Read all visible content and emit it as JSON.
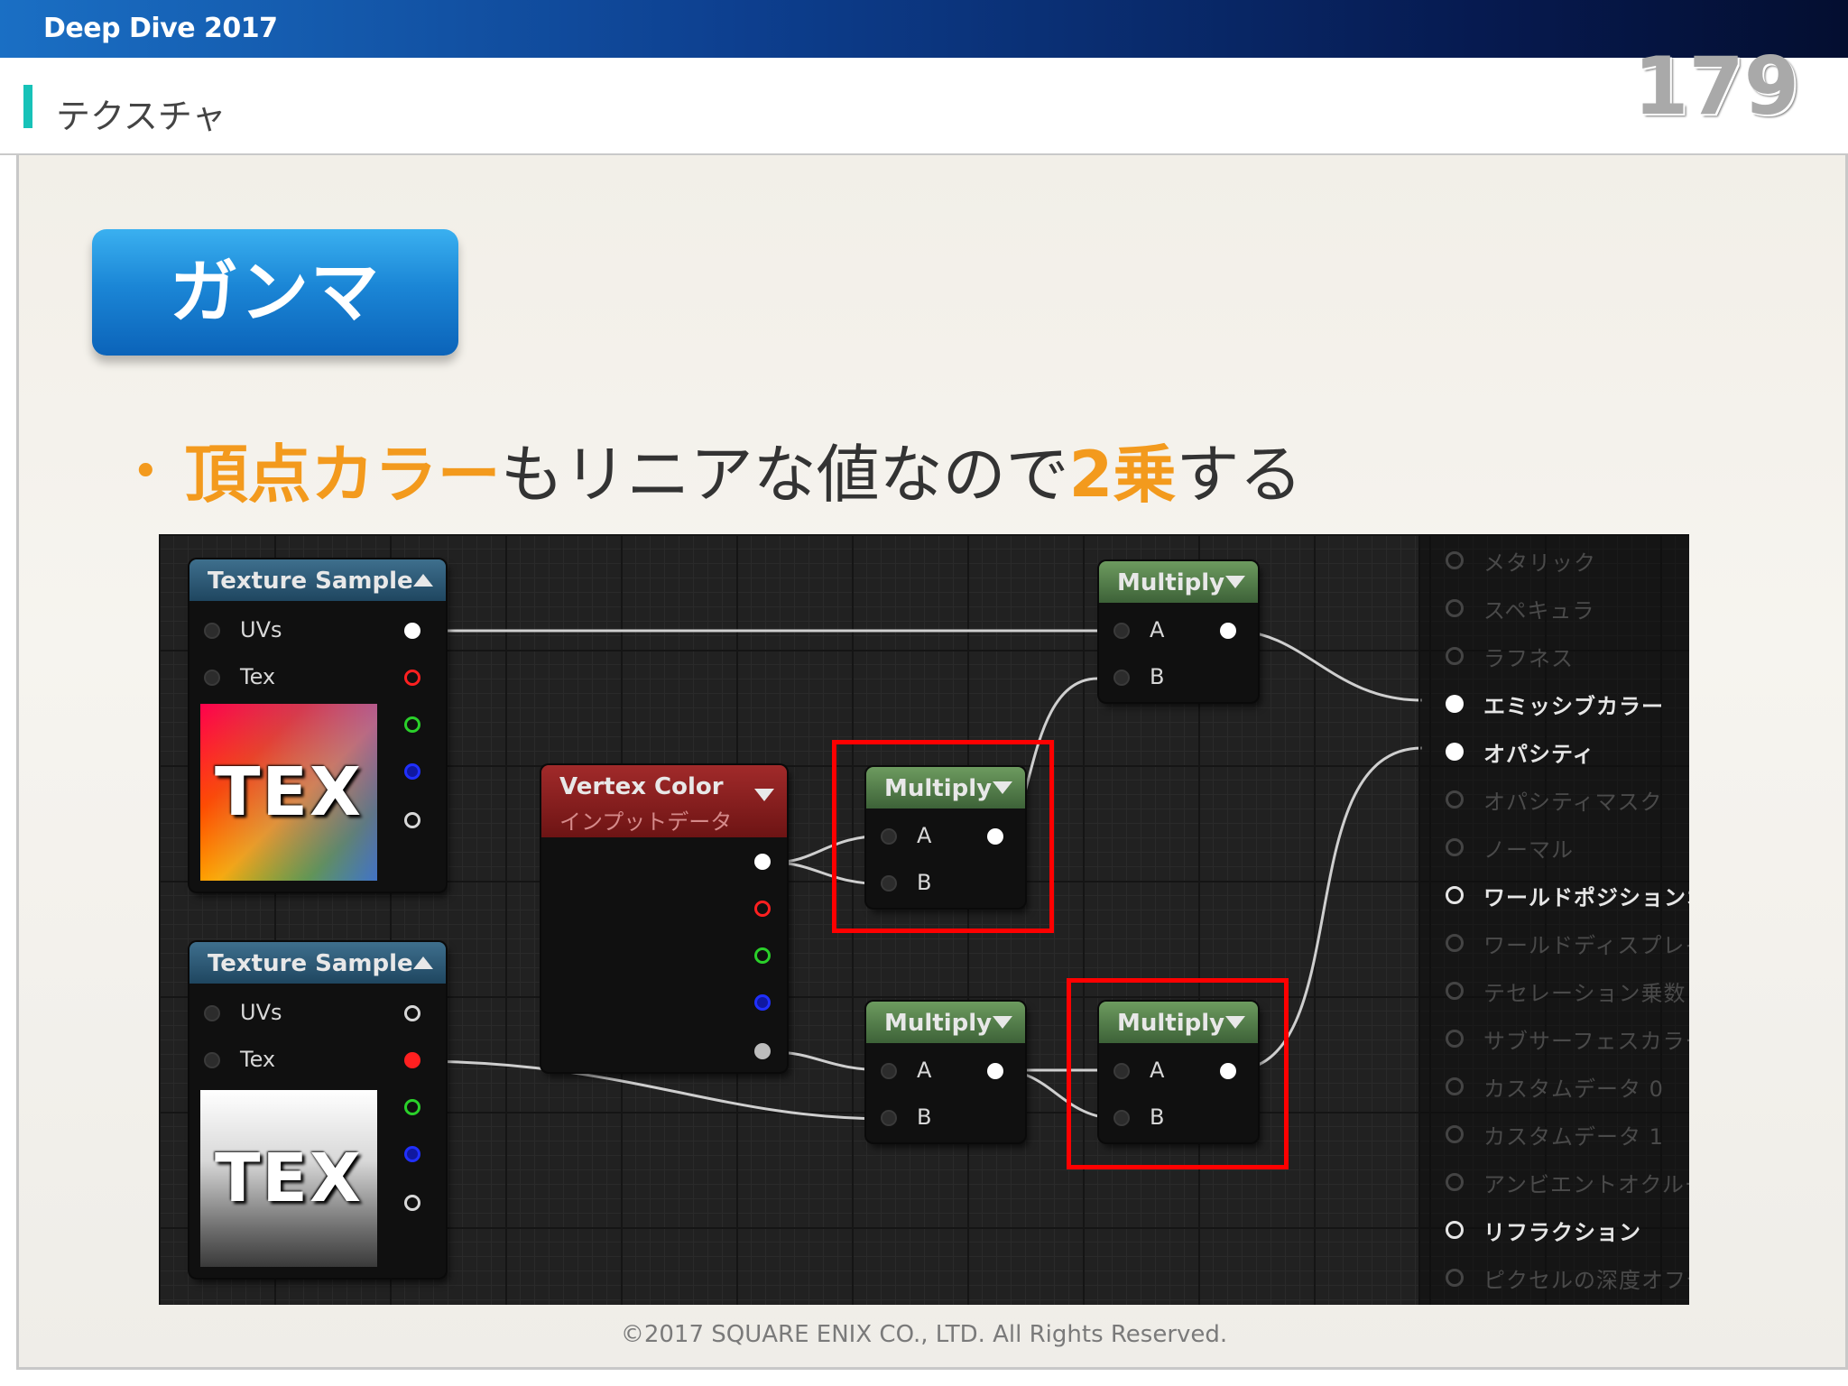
{
  "banner": {
    "title": "Deep Dive 2017"
  },
  "header": {
    "title": "テクスチャ",
    "page_number": "179"
  },
  "section": {
    "label": "ガンマ"
  },
  "bullet": {
    "marker": "•",
    "part1_highlight": "頂点カラー",
    "part2": "もリニアな値なので",
    "part3_highlight": "2乗",
    "part4": "する"
  },
  "editor": {
    "texture_sample_1": {
      "title": "Texture Sample",
      "pin_uvs": "UVs",
      "pin_tex": "Tex",
      "thumb_text": "TEX"
    },
    "texture_sample_2": {
      "title": "Texture Sample",
      "pin_uvs": "UVs",
      "pin_tex": "Tex",
      "thumb_text": "TEX"
    },
    "vertex_color": {
      "title": "Vertex Color",
      "subtitle": "インプットデータ"
    },
    "multiply_top": {
      "title": "Multiply",
      "pin_a": "A",
      "pin_b": "B"
    },
    "multiply_mid": {
      "title": "Multiply",
      "pin_a": "A",
      "pin_b": "B"
    },
    "multiply_bottom_left": {
      "title": "Multiply",
      "pin_a": "A",
      "pin_b": "B"
    },
    "multiply_bottom_right": {
      "title": "Multiply",
      "pin_a": "A",
      "pin_b": "B"
    },
    "outputs": [
      {
        "label": "メタリック",
        "state": "dim"
      },
      {
        "label": "スペキュラ",
        "state": "dim"
      },
      {
        "label": "ラフネス",
        "state": "dim"
      },
      {
        "label": "エミッシブカラー",
        "state": "connected"
      },
      {
        "label": "オパシティ",
        "state": "connected"
      },
      {
        "label": "オパシティマスク",
        "state": "dim"
      },
      {
        "label": "ノーマル",
        "state": "dim"
      },
      {
        "label": "ワールドポジションオ",
        "state": "active"
      },
      {
        "label": "ワールドディスプレイ",
        "state": "dim"
      },
      {
        "label": "テセレーション乗数",
        "state": "dim"
      },
      {
        "label": "サブサーフェスカラー",
        "state": "dim"
      },
      {
        "label": "カスタムデータ 0",
        "state": "dim"
      },
      {
        "label": "カスタムデータ 1",
        "state": "dim"
      },
      {
        "label": "アンビエントオクルー",
        "state": "dim"
      },
      {
        "label": "リフラクション",
        "state": "active"
      },
      {
        "label": "ピクセルの深度オフセ",
        "state": "dim"
      }
    ]
  },
  "footer": {
    "copyright": "©2017 SQUARE ENIX CO., LTD. All Rights Reserved."
  },
  "colors": {
    "accent_orange": "#f39a1d",
    "badge_blue": "#1b86d6",
    "header_bar_teal": "#17c2b8",
    "highlight_red": "#ff0000"
  }
}
